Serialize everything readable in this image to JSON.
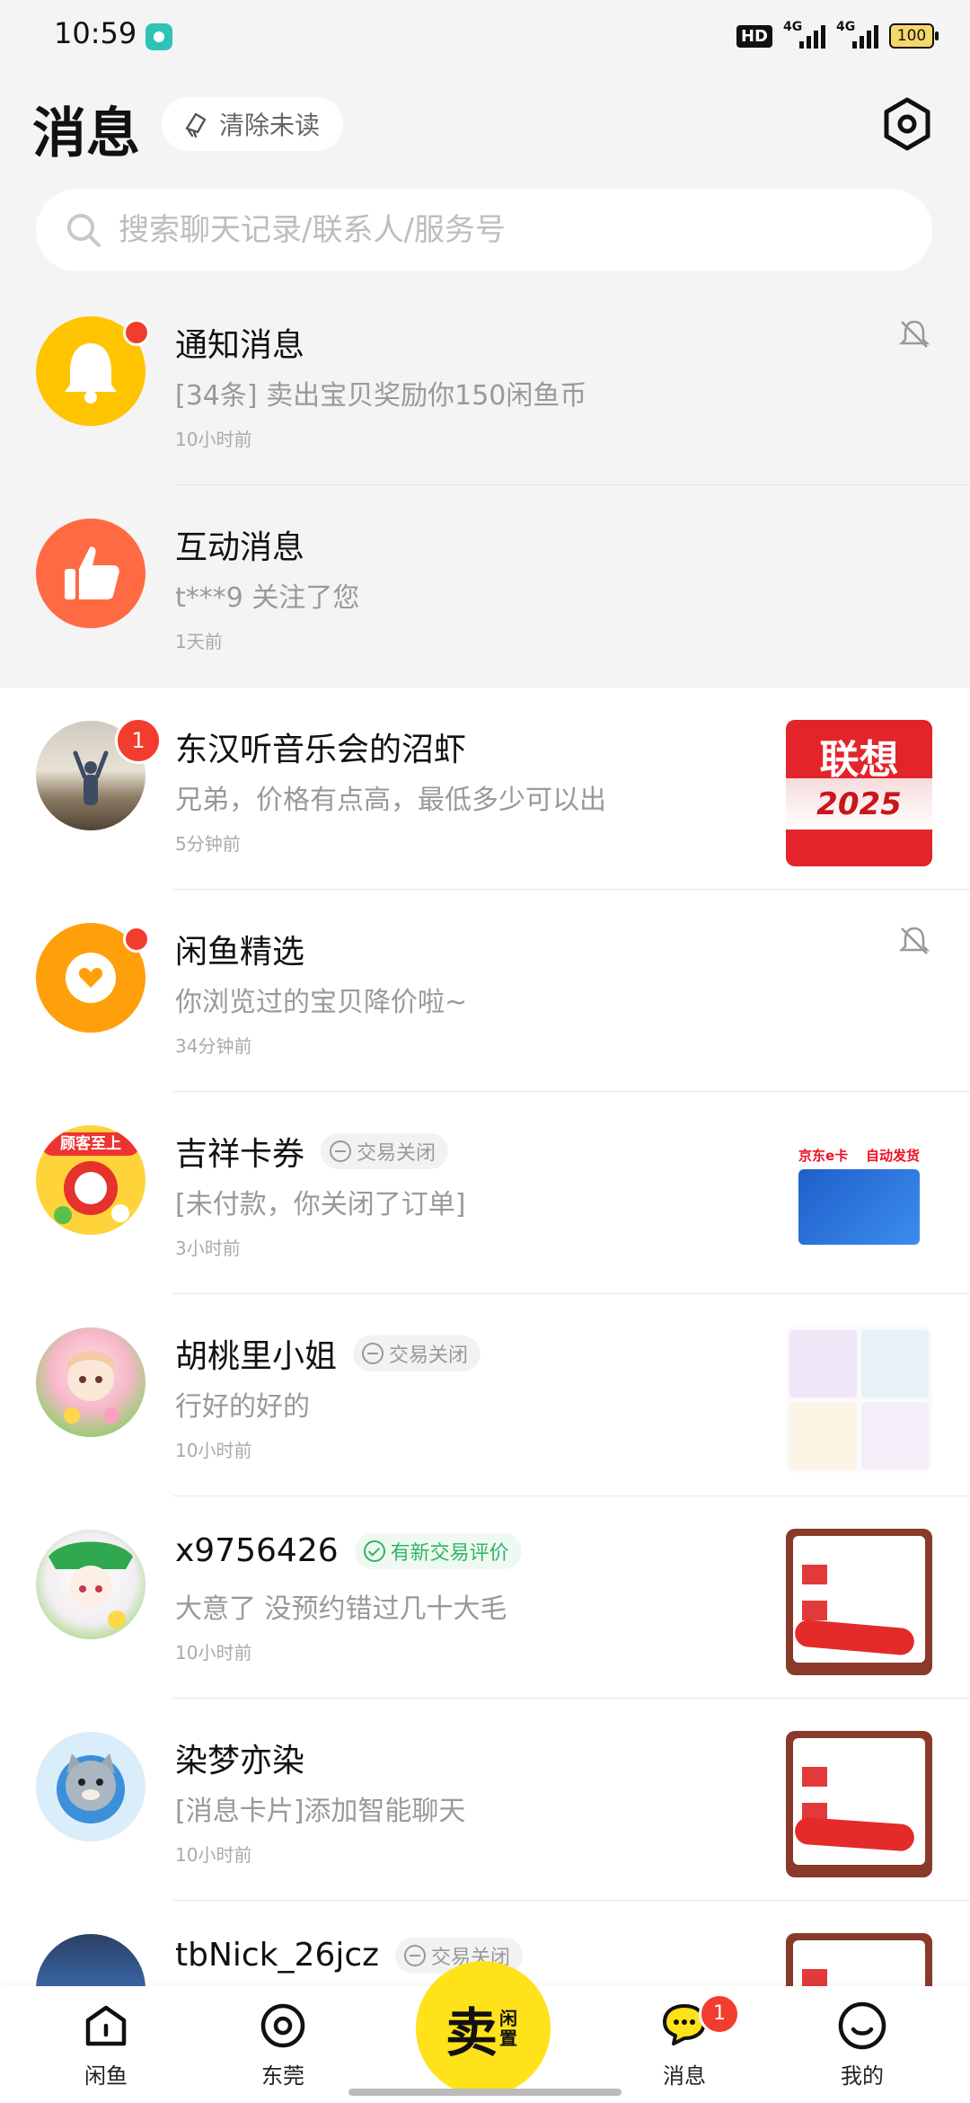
{
  "status_bar": {
    "time": "10:59",
    "hd": "HD",
    "signal1": "4G",
    "signal2": "4G",
    "battery": "100"
  },
  "header": {
    "title": "消息",
    "clear_unread_label": "清除未读",
    "settings_icon": "settings-hexagon-icon"
  },
  "search": {
    "placeholder": "搜索聊天记录/联系人/服务号",
    "value": ""
  },
  "colors": {
    "brand_yellow": "#ffe21a",
    "badge_red": "#f23c2d",
    "bell_yellow": "#ffc400",
    "thumb_orange": "#ff6a43",
    "selection_orange": "#ff9f0a"
  },
  "conversations": [
    {
      "name": "通知消息",
      "message": "[34条] 卖出宝贝奖励你150闲鱼币",
      "time": "10小时前",
      "unread": "dot",
      "muted": true,
      "avatar": "bell-icon"
    },
    {
      "name": "互动消息",
      "message": "t***9 关注了您",
      "time": "1天前",
      "unread": "",
      "muted": false,
      "avatar": "thumbs-up-icon"
    },
    {
      "name": "东汉听音乐会的沼虾",
      "message": "兄弟，价格有点高，最低多少可以出",
      "time": "5分钟前",
      "unread": "1",
      "muted": false,
      "avatar": "photo-avatar",
      "thumb_text": "联想",
      "thumb_sub": "2025"
    },
    {
      "name": "闲鱼精选",
      "message": "你浏览过的宝贝降价啦~",
      "time": "34分钟前",
      "unread": "dot",
      "muted": true,
      "avatar": "heart-icon"
    },
    {
      "name": "吉祥卡券",
      "tag": "交易关闭",
      "message": "[未付款，你关闭了订单]",
      "time": "3小时前",
      "unread": "",
      "muted": false,
      "avatar": "mascot-avatar",
      "avatar_text": "顾客至上",
      "thumb_title": "京东e卡",
      "thumb_label": "自动发货"
    },
    {
      "name": "胡桃里小姐",
      "tag": "交易关闭",
      "message": "行好的好的",
      "time": "10小时前",
      "unread": "",
      "muted": false,
      "avatar": "anime-avatar"
    },
    {
      "name": "x9756426",
      "tag": "有新交易评价",
      "tag_type": "green",
      "message": "大意了 没预约错过几十大毛",
      "time": "10小时前",
      "unread": "",
      "muted": false,
      "avatar": "anime-avatar-2"
    },
    {
      "name": "染梦亦染",
      "message": "[消息卡片]添加智能聊天",
      "time": "10小时前",
      "unread": "",
      "muted": false,
      "avatar": "cat-avatar"
    },
    {
      "name": "tbNick_26jcz",
      "tag": "交易关闭",
      "message": "",
      "time": "",
      "unread": "",
      "muted": false,
      "avatar": "photo-avatar-2"
    }
  ],
  "bottom_nav": {
    "items": [
      {
        "label": "闲鱼",
        "icon": "home-icon"
      },
      {
        "label": "东莞",
        "icon": "location-icon"
      },
      {
        "label": "消息",
        "icon": "chat-icon",
        "badge": "1"
      },
      {
        "label": "我的",
        "icon": "profile-icon"
      }
    ],
    "sell_main": "卖",
    "sell_sub": "闲置"
  }
}
